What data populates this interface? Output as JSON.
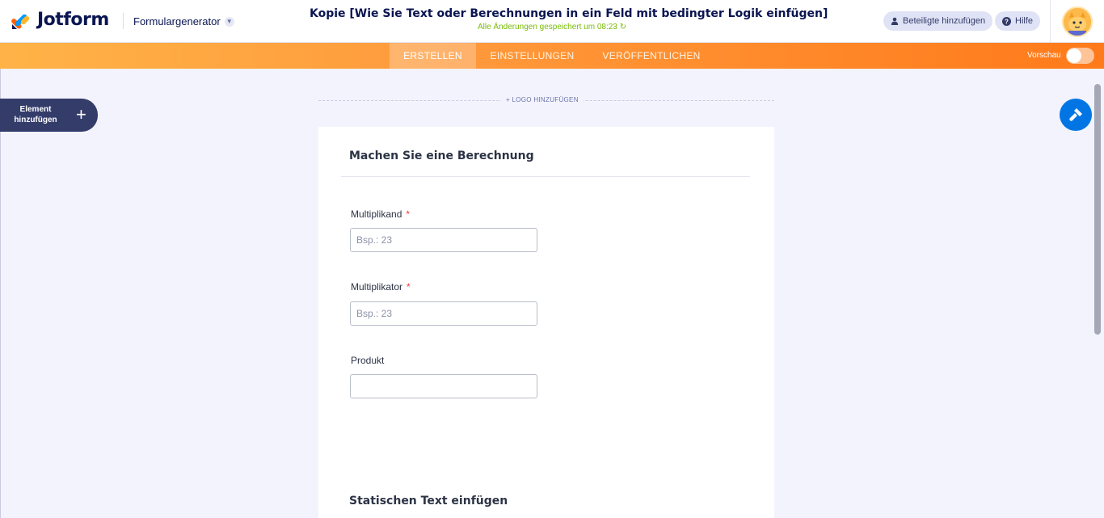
{
  "header": {
    "brand": "Jotform",
    "builder_menu": "Formulargenerator",
    "form_title": "Kopie [Wie Sie Text oder Berechnungen in ein Feld mit bedingter Logik einfügen]",
    "save_status": "Alle Änderungen gespeichert um 08:23",
    "share_label": "Beteiligte hinzufügen",
    "help_label": "Hilfe"
  },
  "tabs": [
    {
      "label": "ERSTELLEN",
      "active": true
    },
    {
      "label": "EINSTELLUNGEN",
      "active": false
    },
    {
      "label": "VERÖFFENTLICHEN",
      "active": false
    }
  ],
  "preview": {
    "label": "Vorschau",
    "on": false
  },
  "sidebar": {
    "add_element_label": "Element hinzufügen"
  },
  "logo_add_label": "+ LOGO HINZUFÜGEN",
  "form": {
    "header": "Machen Sie eine Berechnung",
    "fields": [
      {
        "label": "Multiplikand",
        "required_mark": "*",
        "placeholder": "Bsp.: 23",
        "value": ""
      },
      {
        "label": "Multiplikator",
        "required_mark": "*",
        "placeholder": "Bsp.: 23",
        "value": ""
      },
      {
        "label": "Produkt",
        "placeholder": "",
        "value": ""
      }
    ],
    "section_title": "Statischen Text einfügen"
  },
  "colors": {
    "brand_navy": "#0a1551",
    "orange_start": "#ffb347",
    "orange_end": "#ff7a1a",
    "save_green": "#78bb07",
    "fab_blue": "#0075e3",
    "required_red": "#f23a3c"
  }
}
